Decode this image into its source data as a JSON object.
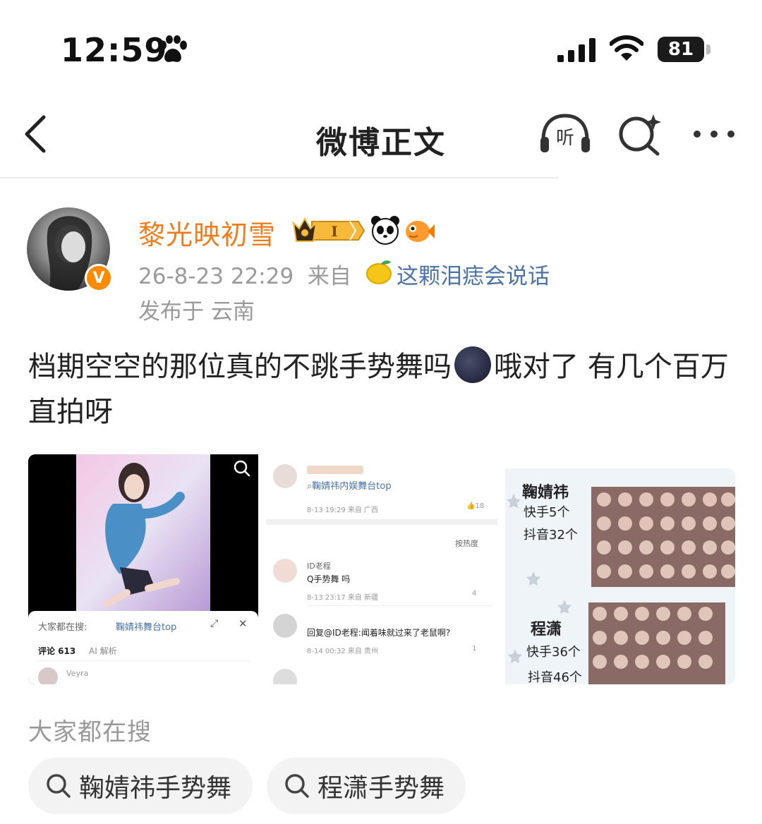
{
  "status_bar": {
    "time": "12:59",
    "battery": "81"
  },
  "nav": {
    "title": "微博正文",
    "listen_label": "听"
  },
  "post": {
    "username": "黎光映初雪",
    "level_badge": "I",
    "verified_badge": "V",
    "timestamp": "26-8-23 22:29",
    "source_prefix": "来自",
    "source": "这颗泪痣会说话",
    "location": "发布于 云南",
    "text_part1": "档期空空的那位真的不跳手势舞吗",
    "text_part2": "哦对了 有几个百万直拍呀"
  },
  "image1": {
    "search_bar_label": "大家都在搜:",
    "search_bar_query": "鞠婧祎舞台top",
    "tab_comments": "评论 613",
    "tab_ai": "AI 解析",
    "commenter": "Veyra"
  },
  "image2": {
    "query": "鞠婧祎内娱舞台top",
    "row1_meta": "8-13 19:29 来自 广西",
    "row1_likes": "18",
    "sort_label": "按热度",
    "c1_user": "ID老程",
    "c1_text": "Q手势舞 吗",
    "c1_meta": "8-13 23:17 来自 新疆",
    "c1_likes": "4",
    "c2_text": "回复@ID老程:闻着味就过来了老鼠啊?",
    "c2_meta": "8-14 00:32 来自 贵州",
    "c2_likes": "1"
  },
  "image3": {
    "name1": "鞠婧祎",
    "name1_line2": "快手5个",
    "name1_line3": "抖音32个",
    "name2": "程潇",
    "name2_line2": "快手36个",
    "name2_line3": "抖音46个"
  },
  "trending": {
    "title": "大家都在搜",
    "items": [
      "鞠婧祎手势舞",
      "程潇手势舞"
    ]
  },
  "colors": {
    "username": "#f07c1e",
    "link": "#4a72a6",
    "meta": "#9a9a9a"
  }
}
